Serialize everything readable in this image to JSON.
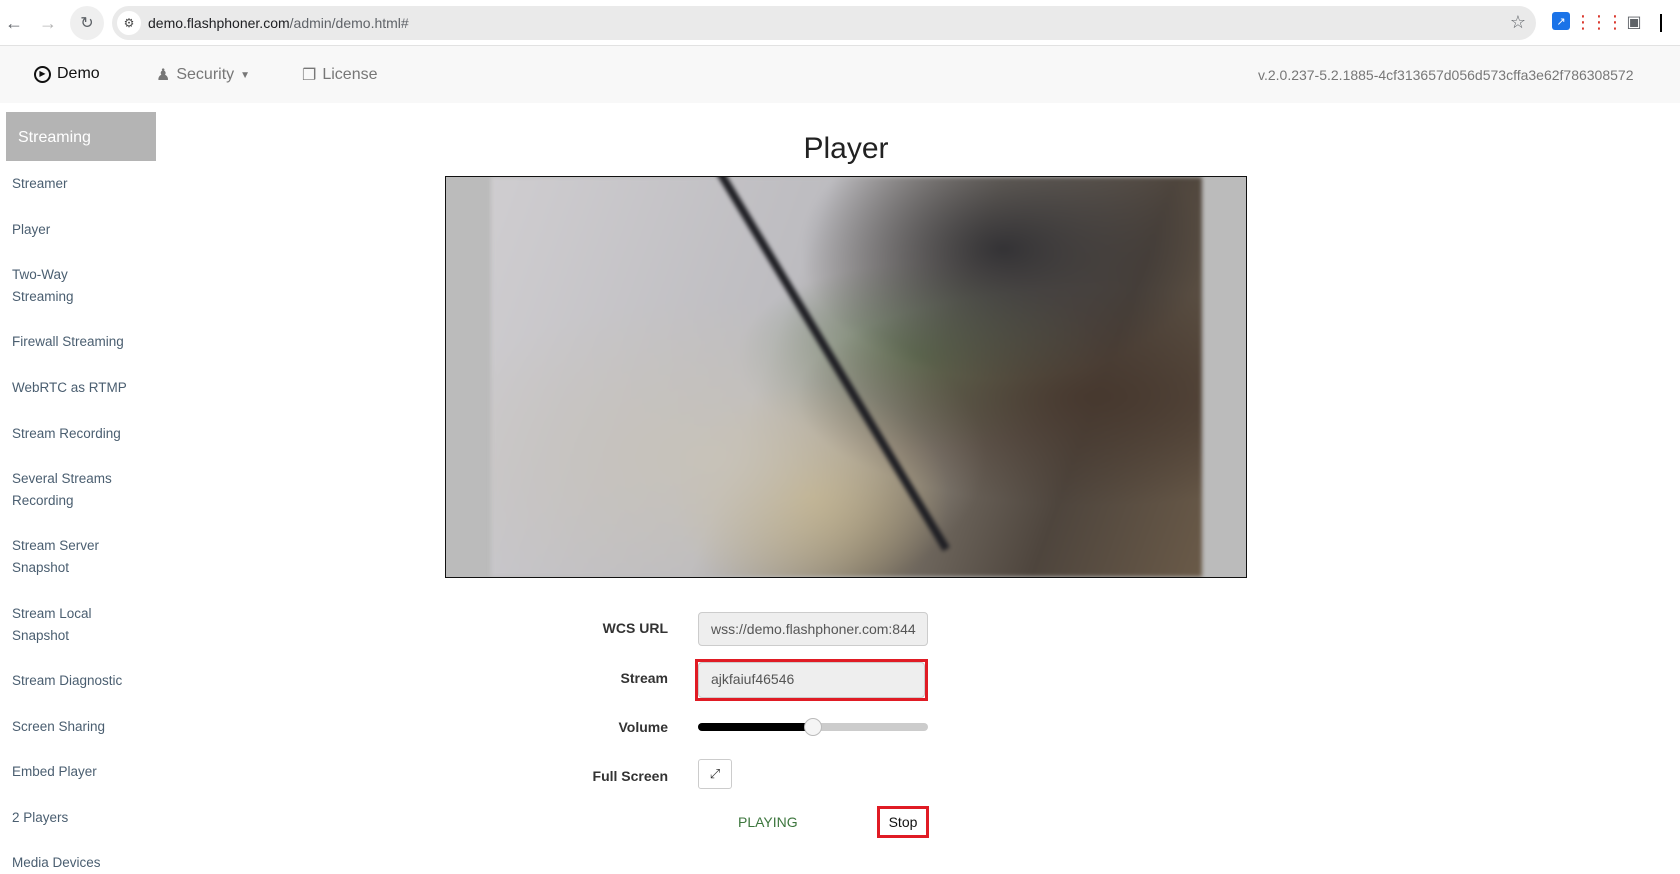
{
  "browser": {
    "url_host": "demo.flashphoner.com",
    "url_path": "/admin/demo.html#"
  },
  "navbar": {
    "demo_label": "Demo",
    "security_label": "Security",
    "license_label": "License",
    "version": "v.2.0.237-5.2.1885-4cf313657d056d573cffa3e62f786308572"
  },
  "sidebar": {
    "header": "Streaming",
    "items": [
      "Streamer",
      "Player",
      "Two-Way Streaming",
      "Firewall Streaming",
      "WebRTC as RTMP",
      "Stream Recording",
      "Several Streams Recording",
      "Stream Server Snapshot",
      "Stream Local Snapshot",
      "Stream Diagnostic",
      "Screen Sharing",
      "Embed Player",
      "2 Players",
      "Media Devices"
    ]
  },
  "main": {
    "title": "Player",
    "wcs_url_label": "WCS URL",
    "wcs_url_value": "wss://demo.flashphoner.com:844",
    "stream_label": "Stream",
    "stream_value": "ajkfaiuf46546",
    "volume_label": "Volume",
    "volume_level_percent": 50,
    "fullscreen_label": "Full Screen",
    "status": "PLAYING",
    "stop_label": "Stop"
  }
}
